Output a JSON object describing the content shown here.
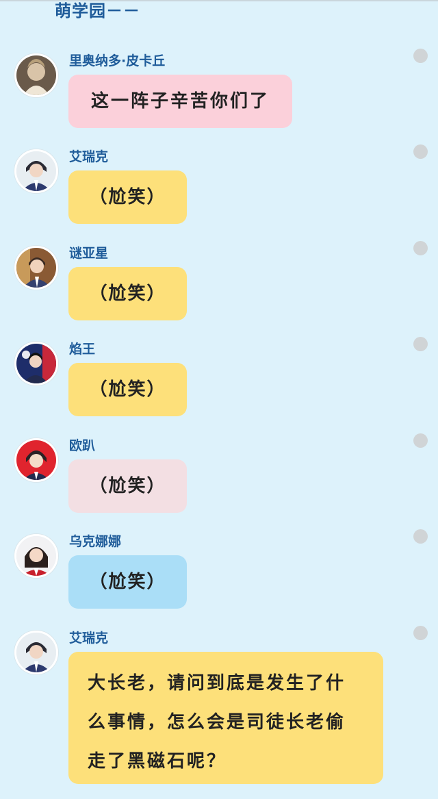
{
  "chat": {
    "title": "萌学园－－",
    "messages": [
      {
        "sender": "里奥纳多·皮卡丘",
        "text": "这一阵子辛苦你们了",
        "bubble_color": "#fbd0da"
      },
      {
        "sender": "艾瑞克",
        "text": "（尬笑）",
        "bubble_color": "#fde07a"
      },
      {
        "sender": "谜亚星",
        "text": "（尬笑）",
        "bubble_color": "#fde07a"
      },
      {
        "sender": "焰王",
        "text": "（尬笑）",
        "bubble_color": "#fde07a"
      },
      {
        "sender": "欧趴",
        "text": "（尬笑）",
        "bubble_color": "#f3dfe3"
      },
      {
        "sender": "乌克娜娜",
        "text": "（尬笑）",
        "bubble_color": "#aadef7"
      },
      {
        "sender": "艾瑞克",
        "text": "大长老，请问到底是发生了什么事情，怎么会是司徒长老偷走了黑磁石呢？",
        "bubble_color": "#fde07a"
      }
    ]
  },
  "colors": {
    "background": "#ddf2fb",
    "name_text": "#1f5c9a",
    "dot": "#d0d4d6"
  },
  "icons": [
    "avatar-pikachu-elder",
    "avatar-eric",
    "avatar-miyaxing",
    "avatar-yanwang",
    "avatar-opa",
    "avatar-ukenana",
    "more-dot-icon"
  ]
}
